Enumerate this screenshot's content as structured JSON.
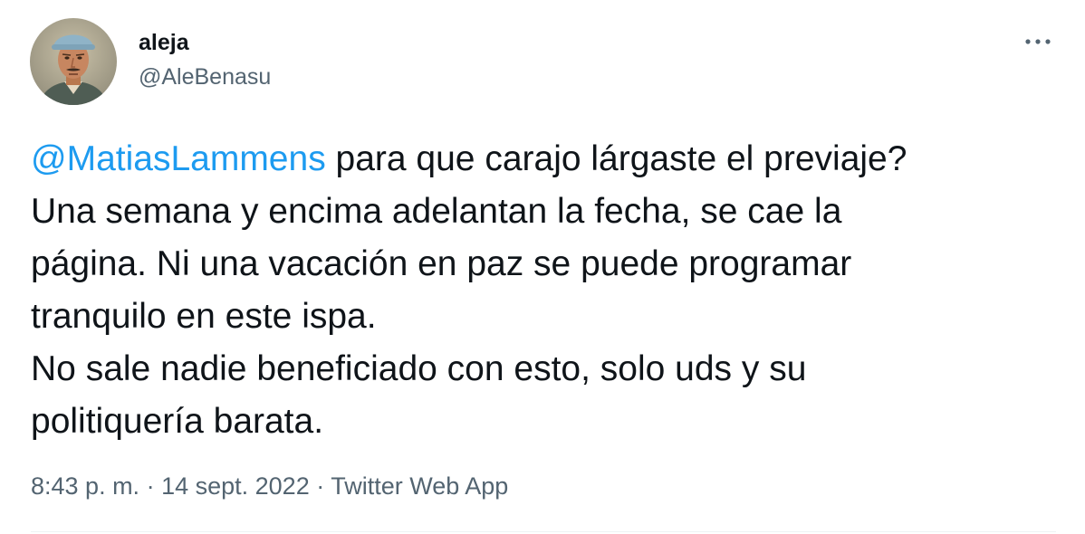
{
  "author": {
    "display_name": "aleja",
    "handle": "@AleBenasu"
  },
  "tweet": {
    "mention": "@MatiasLammens",
    "line1_rest": " para que carajo lárgaste el previaje?",
    "line2": "Una semana y encima adelantan la fecha, se cae la",
    "line3": "página. Ni una vacación en paz se puede programar",
    "line4": "tranquilo en este ispa.",
    "line5": "No sale nadie beneficiado con esto, solo uds y su",
    "line6": "politiquería barata."
  },
  "meta": {
    "time": "8:43 p. m.",
    "separator": " · ",
    "date": "14 sept. 2022",
    "source": "Twitter Web App"
  },
  "icons": {
    "more": "more-horizontal-icon",
    "avatar": "profile-photo"
  },
  "colors": {
    "link": "#1d9bf0",
    "text": "#0f1419",
    "secondary": "#536471"
  }
}
